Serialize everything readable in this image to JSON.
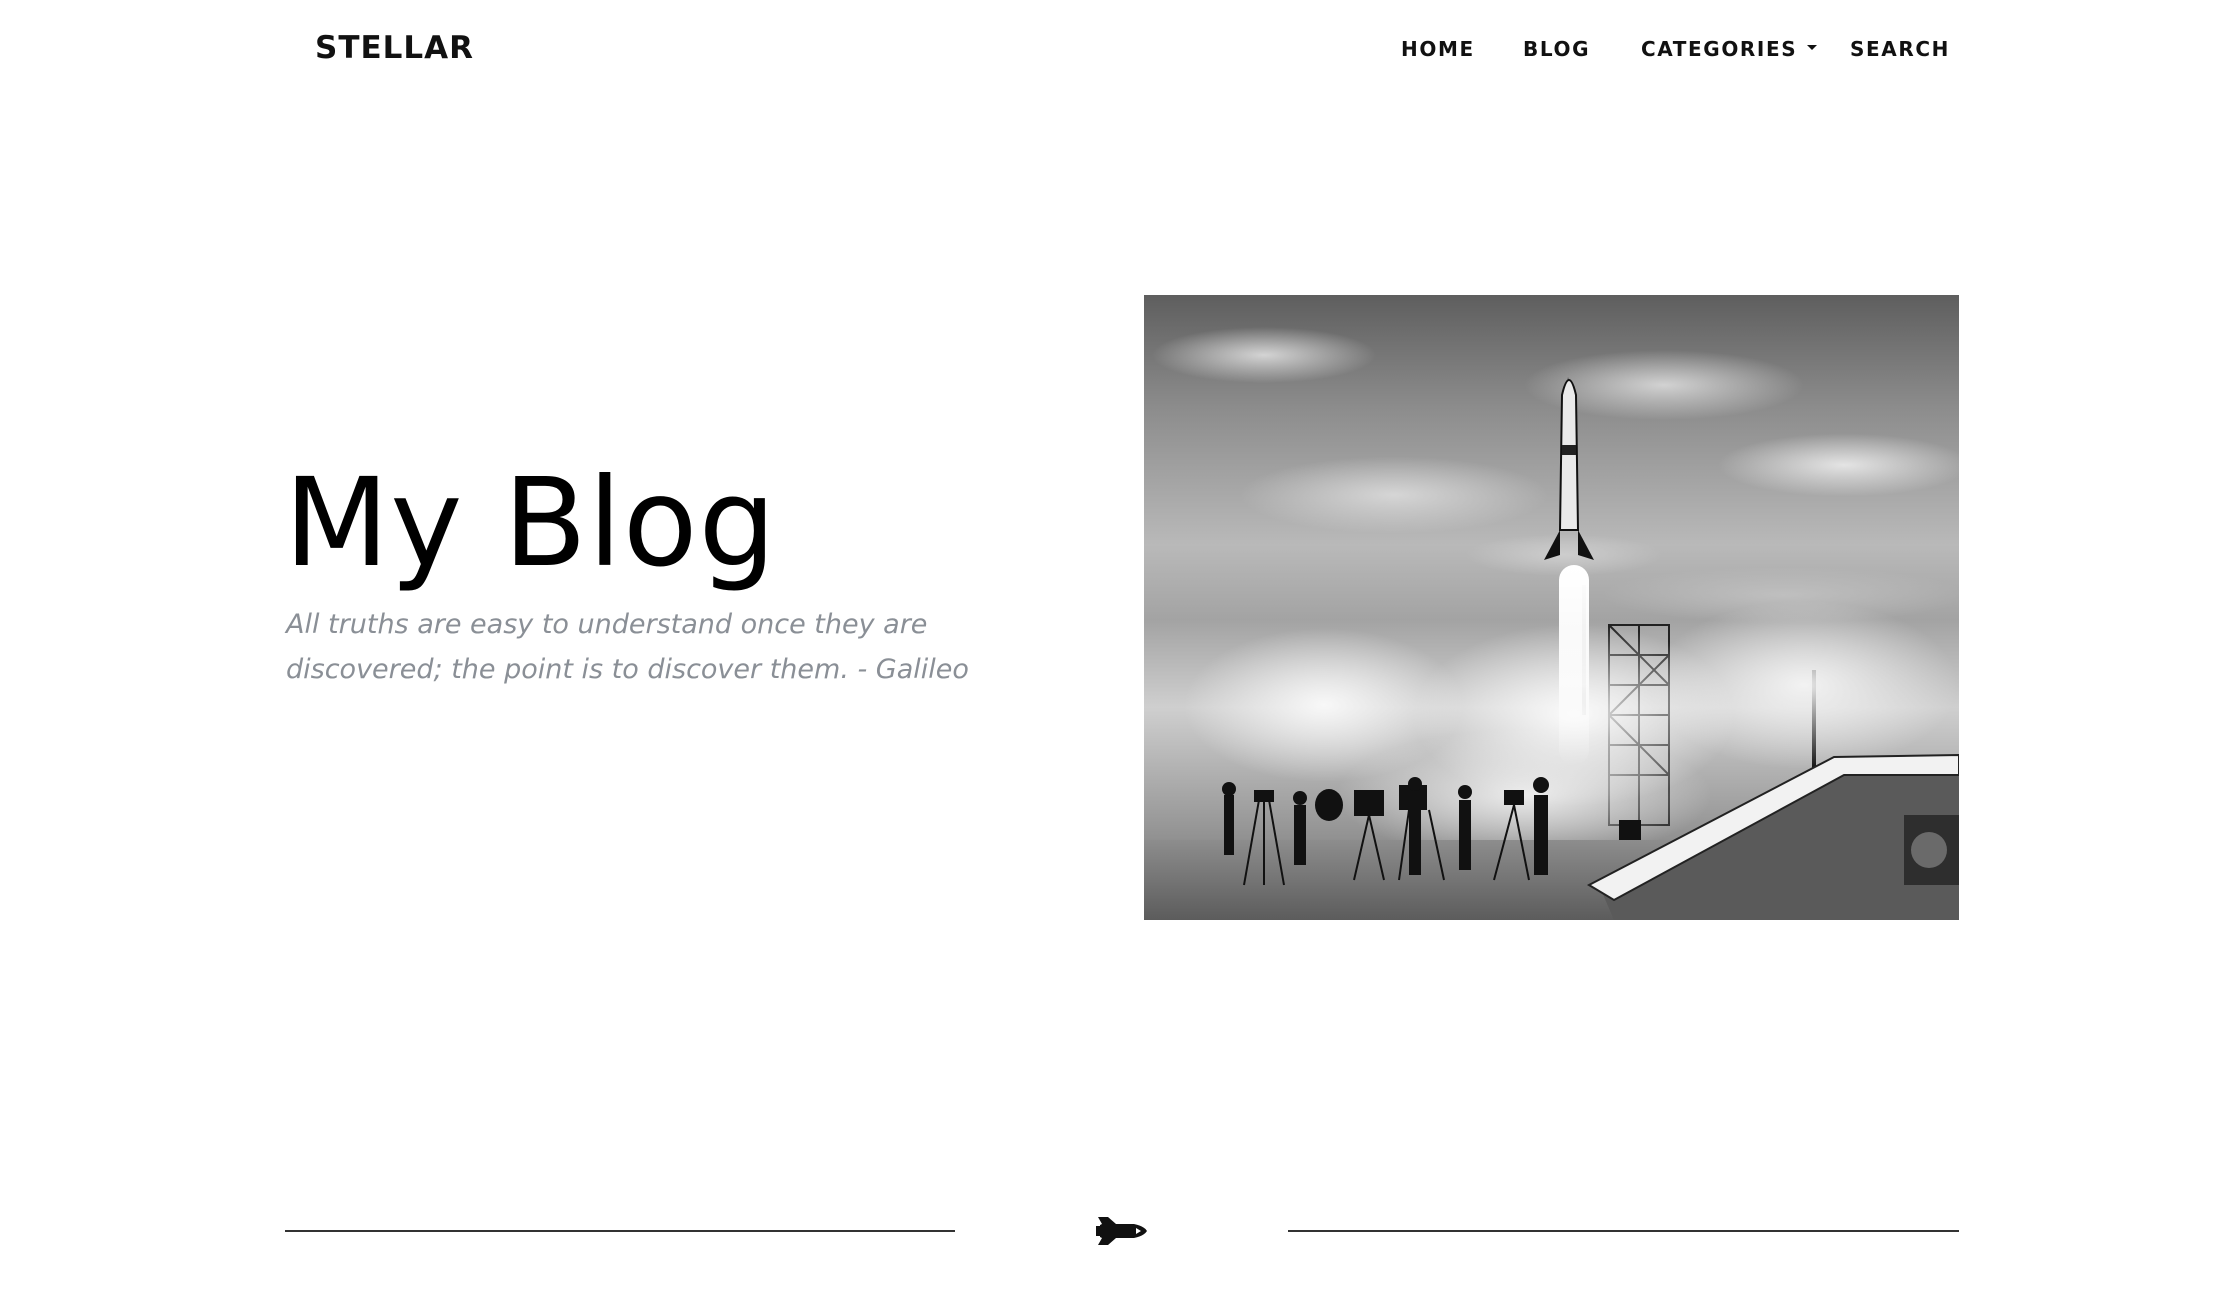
{
  "brand": {
    "name": "STELLAR"
  },
  "nav": {
    "items": [
      {
        "label": "HOME"
      },
      {
        "label": "BLOG"
      },
      {
        "label": "CATEGORIES",
        "icon": "caret-down-icon"
      },
      {
        "label": "SEARCH"
      }
    ]
  },
  "hero": {
    "title": "My Blog",
    "quote": "All truths are easy to understand once they are discovered; the point is to discover them. - Galileo",
    "image": {
      "subject": "rocket-launch-photo",
      "style": "black-and-white"
    }
  },
  "divider": {
    "icon": "space-shuttle-icon"
  },
  "colors": {
    "background": "#ffffff",
    "text": "#000000",
    "quote": "#8a8f96",
    "divider": "#333333"
  }
}
